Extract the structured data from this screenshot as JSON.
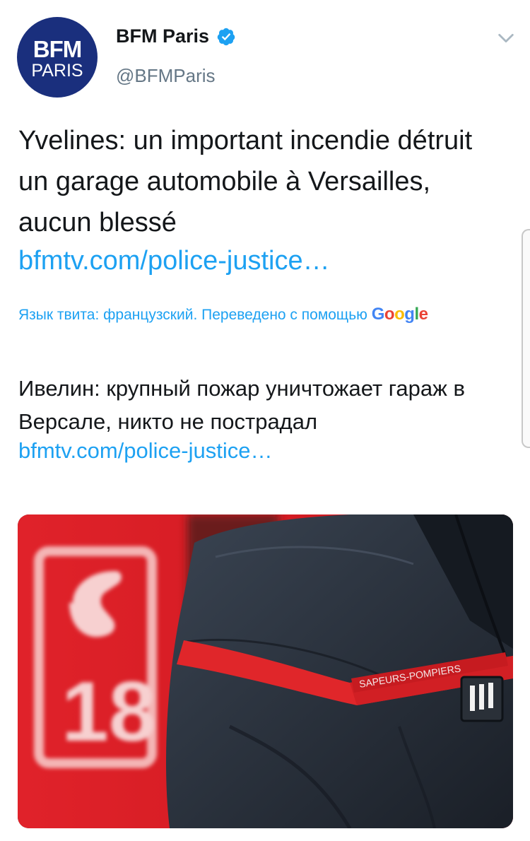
{
  "author": {
    "display_name": "BFM Paris",
    "handle": "@BFMParis",
    "avatar_line1": "BFM",
    "avatar_line2": "PARIS",
    "verified": true
  },
  "tweet": {
    "text": "Yvelines: un important incendie détruit un garage automobile à Versailles, aucun blessé",
    "link": "bfmtv.com/police-justice…"
  },
  "translation": {
    "note": "Язык твита: французский. Переведено с помощью",
    "provider": "Google",
    "text": "Ивелин: крупный пожар уничтожает гараж в Версале, никто не пострадал",
    "link": "bfmtv.com/police-justice…"
  },
  "media": {
    "sign_number": "18",
    "badge_text": "SAPEURS-POMPIERS",
    "rank_marks": "III"
  },
  "colors": {
    "link": "#1da1f2",
    "text": "#14171a",
    "secondary": "#657786",
    "brand_navy": "#1a2f7d",
    "sign_red": "#e0222a"
  },
  "icons": {
    "verified": "verified-badge-icon",
    "menu": "chevron-down-icon"
  }
}
